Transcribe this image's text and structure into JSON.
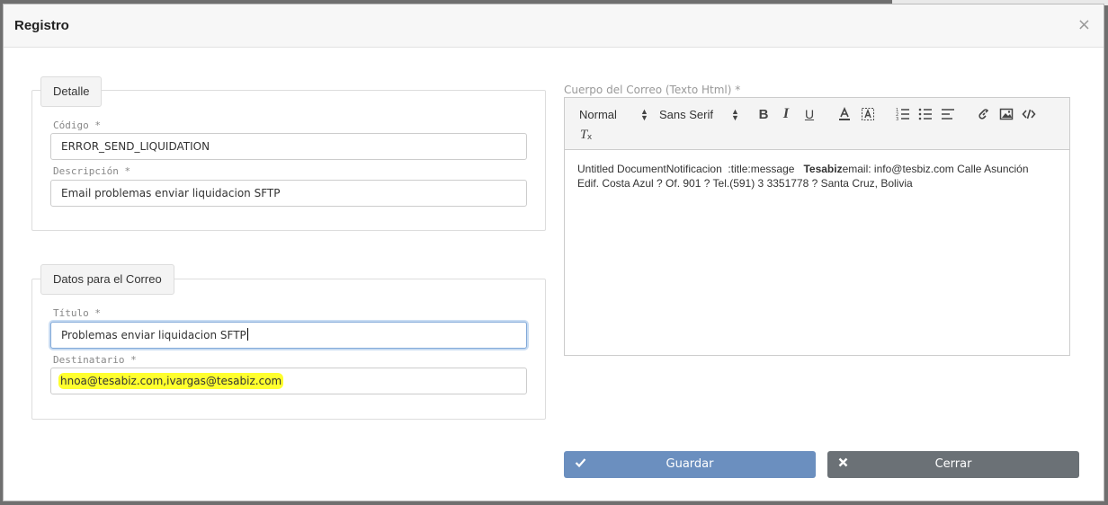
{
  "modal": {
    "title": "Registro",
    "close_symbol": "×"
  },
  "detalle": {
    "legend": "Detalle",
    "codigo_label": "Código *",
    "codigo_value": "ERROR_SEND_LIQUIDATION",
    "descripcion_label": "Descripción *",
    "descripcion_value": "Email problemas enviar liquidacion SFTP"
  },
  "correo": {
    "legend": "Datos para el Correo",
    "titulo_label": "Título *",
    "titulo_value": "Problemas enviar liquidacion SFTP",
    "destinatario_label": "Destinatario *",
    "destinatario_value": "hnoa@tesabiz.com,ivargas@tesabiz.com"
  },
  "editor": {
    "label": "Cuerpo del Correo (Texto Html) *",
    "size_select": "Normal",
    "font_select": "Sans Serif",
    "body_line1_a": "Untitled DocumentNotificacion  :title:message   ",
    "body_line1_bold": "Tesabiz",
    "body_line1_b": "email: info@tesbiz.com Calle Asunción",
    "body_line2": "Edif. Costa Azul ? Of. 901 ? Tel.(591) 3 3351778 ? Santa Cruz, Bolivia"
  },
  "actions": {
    "save_label": "Guardar",
    "close_label": "Cerrar"
  },
  "icons": [
    "bold-icon",
    "italic-icon",
    "underline-icon",
    "font-color-icon",
    "background-color-icon",
    "ordered-list-icon",
    "bullet-list-icon",
    "align-icon",
    "link-icon",
    "image-icon",
    "code-icon",
    "clear-format-icon",
    "check-icon",
    "close-icon"
  ]
}
